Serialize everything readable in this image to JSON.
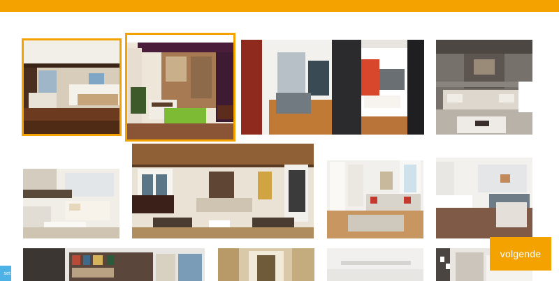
{
  "header": {
    "accent_color": "#f3a200"
  },
  "gallery": {
    "items": [
      {
        "name": "interior-bedroom-1",
        "selected": true
      },
      {
        "name": "interior-living-balcony",
        "selected": true
      },
      {
        "name": "interior-loft-stairs",
        "selected": false
      },
      {
        "name": "interior-grey-lounge",
        "selected": false
      },
      {
        "name": "interior-white-living",
        "selected": false
      },
      {
        "name": "interior-wood-ceiling",
        "selected": false
      },
      {
        "name": "interior-bright-sofa",
        "selected": false
      },
      {
        "name": "interior-open-kitchen",
        "selected": false
      },
      {
        "name": "interior-bookshelf",
        "selected": false
      },
      {
        "name": "interior-hallway",
        "selected": false
      },
      {
        "name": "interior-white-room",
        "selected": false
      },
      {
        "name": "interior-gallery-wall",
        "selected": false
      }
    ]
  },
  "actions": {
    "next_label": "volgende",
    "reset_label": "set"
  }
}
